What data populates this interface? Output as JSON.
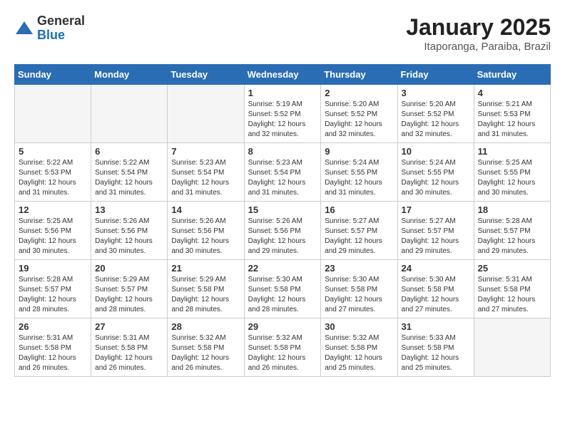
{
  "logo": {
    "general": "General",
    "blue": "Blue"
  },
  "title": "January 2025",
  "subtitle": "Itaporanga, Paraiba, Brazil",
  "days_of_week": [
    "Sunday",
    "Monday",
    "Tuesday",
    "Wednesday",
    "Thursday",
    "Friday",
    "Saturday"
  ],
  "weeks": [
    [
      {
        "day": "",
        "info": ""
      },
      {
        "day": "",
        "info": ""
      },
      {
        "day": "",
        "info": ""
      },
      {
        "day": "1",
        "info": "Sunrise: 5:19 AM\nSunset: 5:52 PM\nDaylight: 12 hours and 32 minutes."
      },
      {
        "day": "2",
        "info": "Sunrise: 5:20 AM\nSunset: 5:52 PM\nDaylight: 12 hours and 32 minutes."
      },
      {
        "day": "3",
        "info": "Sunrise: 5:20 AM\nSunset: 5:52 PM\nDaylight: 12 hours and 32 minutes."
      },
      {
        "day": "4",
        "info": "Sunrise: 5:21 AM\nSunset: 5:53 PM\nDaylight: 12 hours and 31 minutes."
      }
    ],
    [
      {
        "day": "5",
        "info": "Sunrise: 5:22 AM\nSunset: 5:53 PM\nDaylight: 12 hours and 31 minutes."
      },
      {
        "day": "6",
        "info": "Sunrise: 5:22 AM\nSunset: 5:54 PM\nDaylight: 12 hours and 31 minutes."
      },
      {
        "day": "7",
        "info": "Sunrise: 5:23 AM\nSunset: 5:54 PM\nDaylight: 12 hours and 31 minutes."
      },
      {
        "day": "8",
        "info": "Sunrise: 5:23 AM\nSunset: 5:54 PM\nDaylight: 12 hours and 31 minutes."
      },
      {
        "day": "9",
        "info": "Sunrise: 5:24 AM\nSunset: 5:55 PM\nDaylight: 12 hours and 31 minutes."
      },
      {
        "day": "10",
        "info": "Sunrise: 5:24 AM\nSunset: 5:55 PM\nDaylight: 12 hours and 30 minutes."
      },
      {
        "day": "11",
        "info": "Sunrise: 5:25 AM\nSunset: 5:55 PM\nDaylight: 12 hours and 30 minutes."
      }
    ],
    [
      {
        "day": "12",
        "info": "Sunrise: 5:25 AM\nSunset: 5:56 PM\nDaylight: 12 hours and 30 minutes."
      },
      {
        "day": "13",
        "info": "Sunrise: 5:26 AM\nSunset: 5:56 PM\nDaylight: 12 hours and 30 minutes."
      },
      {
        "day": "14",
        "info": "Sunrise: 5:26 AM\nSunset: 5:56 PM\nDaylight: 12 hours and 30 minutes."
      },
      {
        "day": "15",
        "info": "Sunrise: 5:26 AM\nSunset: 5:56 PM\nDaylight: 12 hours and 29 minutes."
      },
      {
        "day": "16",
        "info": "Sunrise: 5:27 AM\nSunset: 5:57 PM\nDaylight: 12 hours and 29 minutes."
      },
      {
        "day": "17",
        "info": "Sunrise: 5:27 AM\nSunset: 5:57 PM\nDaylight: 12 hours and 29 minutes."
      },
      {
        "day": "18",
        "info": "Sunrise: 5:28 AM\nSunset: 5:57 PM\nDaylight: 12 hours and 29 minutes."
      }
    ],
    [
      {
        "day": "19",
        "info": "Sunrise: 5:28 AM\nSunset: 5:57 PM\nDaylight: 12 hours and 28 minutes."
      },
      {
        "day": "20",
        "info": "Sunrise: 5:29 AM\nSunset: 5:57 PM\nDaylight: 12 hours and 28 minutes."
      },
      {
        "day": "21",
        "info": "Sunrise: 5:29 AM\nSunset: 5:58 PM\nDaylight: 12 hours and 28 minutes."
      },
      {
        "day": "22",
        "info": "Sunrise: 5:30 AM\nSunset: 5:58 PM\nDaylight: 12 hours and 28 minutes."
      },
      {
        "day": "23",
        "info": "Sunrise: 5:30 AM\nSunset: 5:58 PM\nDaylight: 12 hours and 27 minutes."
      },
      {
        "day": "24",
        "info": "Sunrise: 5:30 AM\nSunset: 5:58 PM\nDaylight: 12 hours and 27 minutes."
      },
      {
        "day": "25",
        "info": "Sunrise: 5:31 AM\nSunset: 5:58 PM\nDaylight: 12 hours and 27 minutes."
      }
    ],
    [
      {
        "day": "26",
        "info": "Sunrise: 5:31 AM\nSunset: 5:58 PM\nDaylight: 12 hours and 26 minutes."
      },
      {
        "day": "27",
        "info": "Sunrise: 5:31 AM\nSunset: 5:58 PM\nDaylight: 12 hours and 26 minutes."
      },
      {
        "day": "28",
        "info": "Sunrise: 5:32 AM\nSunset: 5:58 PM\nDaylight: 12 hours and 26 minutes."
      },
      {
        "day": "29",
        "info": "Sunrise: 5:32 AM\nSunset: 5:58 PM\nDaylight: 12 hours and 26 minutes."
      },
      {
        "day": "30",
        "info": "Sunrise: 5:32 AM\nSunset: 5:58 PM\nDaylight: 12 hours and 25 minutes."
      },
      {
        "day": "31",
        "info": "Sunrise: 5:33 AM\nSunset: 5:58 PM\nDaylight: 12 hours and 25 minutes."
      },
      {
        "day": "",
        "info": ""
      }
    ]
  ]
}
